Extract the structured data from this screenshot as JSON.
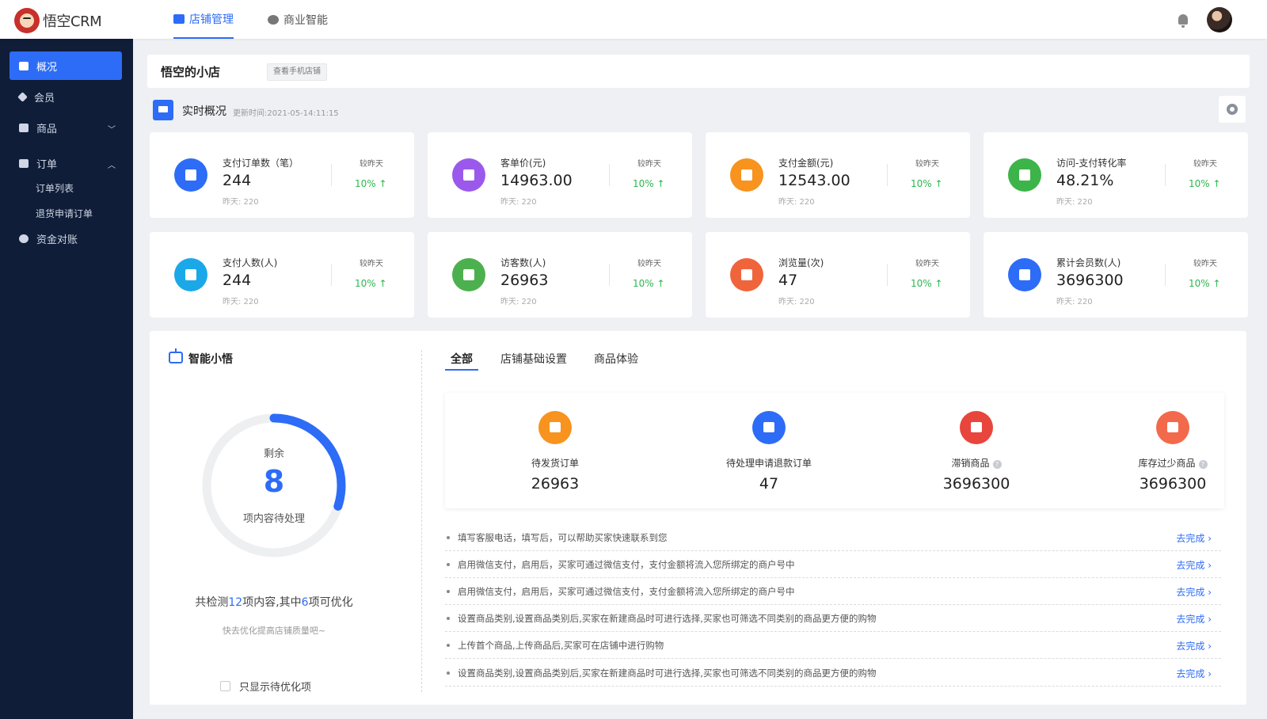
{
  "app": {
    "logo_text": "悟空CRM"
  },
  "header": {
    "tabs": [
      {
        "label": "店铺管理",
        "icon": "store-icon",
        "active": true
      },
      {
        "label": "商业智能",
        "icon": "bi-icon",
        "active": false
      }
    ]
  },
  "sidebar": {
    "items": [
      {
        "label": "概况",
        "icon": "monitor-icon",
        "active": true
      },
      {
        "label": "会员",
        "icon": "diamond-icon",
        "active": false,
        "chevron": ""
      },
      {
        "label": "商品",
        "icon": "box-icon",
        "active": false,
        "chevron": "﹀"
      },
      {
        "label": "订单",
        "icon": "order-icon",
        "active": false,
        "chevron": "︿"
      },
      {
        "label": "资金对账",
        "icon": "money-bag-icon",
        "active": false
      }
    ],
    "order_subitems": [
      "订单列表",
      "退货申请订单"
    ]
  },
  "shop": {
    "name": "悟空的小店",
    "mobile_button": "查看手机店铺"
  },
  "realtime": {
    "title": "实时概况",
    "update_time": "更新时间:2021-05-14:11:15"
  },
  "stats": [
    {
      "label": "支付订单数（笔）",
      "value": "244",
      "yesterday": "昨天: 220",
      "compare": "较昨天",
      "pct": "10% ↑",
      "color": "#2d6cf6"
    },
    {
      "label": "客单价(元)",
      "value": "14963.00",
      "yesterday": "昨天: 220",
      "compare": "较昨天",
      "pct": "10% ↑",
      "color": "#9b59ec"
    },
    {
      "label": "支付金额(元)",
      "value": "12543.00",
      "yesterday": "昨天: 220",
      "compare": "较昨天",
      "pct": "10% ↑",
      "color": "#f7931e"
    },
    {
      "label": "访问-支付转化率",
      "value": "48.21%",
      "yesterday": "昨天: 220",
      "compare": "较昨天",
      "pct": "10% ↑",
      "color": "#3cb44a"
    },
    {
      "label": "支付人数(人)",
      "value": "244",
      "yesterday": "昨天: 220",
      "compare": "较昨天",
      "pct": "10% ↑",
      "color": "#1ba8e8"
    },
    {
      "label": "访客数(人)",
      "value": "26963",
      "yesterday": "昨天: 220",
      "compare": "较昨天",
      "pct": "10% ↑",
      "color": "#4cb04f"
    },
    {
      "label": "浏览量(次)",
      "value": "47",
      "yesterday": "昨天: 220",
      "compare": "较昨天",
      "pct": "10% ↑",
      "color": "#f0643c"
    },
    {
      "label": "累计会员数(人)",
      "value": "3696300",
      "yesterday": "昨天: 220",
      "compare": "较昨天",
      "pct": "10% ↑",
      "color": "#2d6cf6"
    }
  ],
  "smart": {
    "title": "智能小悟",
    "ring_label_top": "剩余",
    "ring_number": "8",
    "ring_label_bottom": "项内容待处理",
    "progress_fraction": 0.3,
    "summary_prefix": "共检测",
    "summary_total": "12",
    "summary_mid": "项内容,其中",
    "summary_opt": "6",
    "summary_suffix": "项可优化",
    "sub_text": "快去优化提高店铺质量吧~",
    "checkbox_label": "只显示待优化项"
  },
  "tabs2": [
    "全部",
    "店铺基础设置",
    "商品体验"
  ],
  "todos": [
    {
      "label": "待发货订单",
      "value": "26963",
      "color": "#f7931e",
      "help": false
    },
    {
      "label": "待处理申请退款订单",
      "value": "47",
      "color": "#2d6cf6",
      "help": false
    },
    {
      "label": "滞销商品",
      "value": "3696300",
      "color": "#e8453c",
      "help": true
    },
    {
      "label": "库存过少商品",
      "value": "3696300",
      "color": "#f26a4b",
      "help": true
    }
  ],
  "tasks": [
    {
      "text": "填写客服电话，填写后，可以帮助买家快速联系到您",
      "action": "去完成 ›"
    },
    {
      "text": "启用微信支付，启用后，买家可通过微信支付，支付金额将流入您所绑定的商户号中",
      "action": "去完成 ›"
    },
    {
      "text": "启用微信支付，启用后，买家可通过微信支付，支付金额将流入您所绑定的商户号中",
      "action": "去完成 ›"
    },
    {
      "text": "设置商品类别,设置商品类别后,买家在新建商品时可进行选择,买家也可筛选不同类别的商品更方便的购物",
      "action": "去完成 ›"
    },
    {
      "text": "上传首个商品,上传商品后,买家可在店铺中进行购物",
      "action": "去完成 ›"
    },
    {
      "text": "设置商品类别,设置商品类别后,买家在新建商品时可进行选择,买家也可筛选不同类别的商品更方便的购物",
      "action": "去完成 ›"
    }
  ]
}
